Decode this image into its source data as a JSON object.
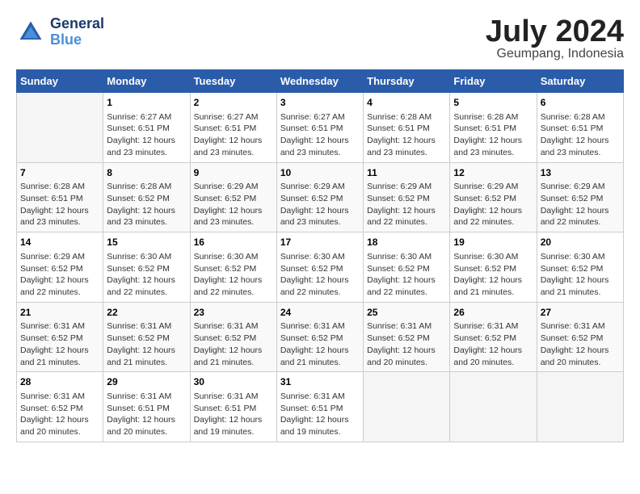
{
  "header": {
    "logo_line1": "General",
    "logo_line2": "Blue",
    "month_year": "July 2024",
    "location": "Geumpang, Indonesia"
  },
  "days_of_week": [
    "Sunday",
    "Monday",
    "Tuesday",
    "Wednesday",
    "Thursday",
    "Friday",
    "Saturday"
  ],
  "weeks": [
    [
      {
        "day": "",
        "info": ""
      },
      {
        "day": "1",
        "info": "Sunrise: 6:27 AM\nSunset: 6:51 PM\nDaylight: 12 hours\nand 23 minutes."
      },
      {
        "day": "2",
        "info": "Sunrise: 6:27 AM\nSunset: 6:51 PM\nDaylight: 12 hours\nand 23 minutes."
      },
      {
        "day": "3",
        "info": "Sunrise: 6:27 AM\nSunset: 6:51 PM\nDaylight: 12 hours\nand 23 minutes."
      },
      {
        "day": "4",
        "info": "Sunrise: 6:28 AM\nSunset: 6:51 PM\nDaylight: 12 hours\nand 23 minutes."
      },
      {
        "day": "5",
        "info": "Sunrise: 6:28 AM\nSunset: 6:51 PM\nDaylight: 12 hours\nand 23 minutes."
      },
      {
        "day": "6",
        "info": "Sunrise: 6:28 AM\nSunset: 6:51 PM\nDaylight: 12 hours\nand 23 minutes."
      }
    ],
    [
      {
        "day": "7",
        "info": "Sunrise: 6:28 AM\nSunset: 6:51 PM\nDaylight: 12 hours\nand 23 minutes."
      },
      {
        "day": "8",
        "info": "Sunrise: 6:28 AM\nSunset: 6:52 PM\nDaylight: 12 hours\nand 23 minutes."
      },
      {
        "day": "9",
        "info": "Sunrise: 6:29 AM\nSunset: 6:52 PM\nDaylight: 12 hours\nand 23 minutes."
      },
      {
        "day": "10",
        "info": "Sunrise: 6:29 AM\nSunset: 6:52 PM\nDaylight: 12 hours\nand 23 minutes."
      },
      {
        "day": "11",
        "info": "Sunrise: 6:29 AM\nSunset: 6:52 PM\nDaylight: 12 hours\nand 22 minutes."
      },
      {
        "day": "12",
        "info": "Sunrise: 6:29 AM\nSunset: 6:52 PM\nDaylight: 12 hours\nand 22 minutes."
      },
      {
        "day": "13",
        "info": "Sunrise: 6:29 AM\nSunset: 6:52 PM\nDaylight: 12 hours\nand 22 minutes."
      }
    ],
    [
      {
        "day": "14",
        "info": "Sunrise: 6:29 AM\nSunset: 6:52 PM\nDaylight: 12 hours\nand 22 minutes."
      },
      {
        "day": "15",
        "info": "Sunrise: 6:30 AM\nSunset: 6:52 PM\nDaylight: 12 hours\nand 22 minutes."
      },
      {
        "day": "16",
        "info": "Sunrise: 6:30 AM\nSunset: 6:52 PM\nDaylight: 12 hours\nand 22 minutes."
      },
      {
        "day": "17",
        "info": "Sunrise: 6:30 AM\nSunset: 6:52 PM\nDaylight: 12 hours\nand 22 minutes."
      },
      {
        "day": "18",
        "info": "Sunrise: 6:30 AM\nSunset: 6:52 PM\nDaylight: 12 hours\nand 22 minutes."
      },
      {
        "day": "19",
        "info": "Sunrise: 6:30 AM\nSunset: 6:52 PM\nDaylight: 12 hours\nand 21 minutes."
      },
      {
        "day": "20",
        "info": "Sunrise: 6:30 AM\nSunset: 6:52 PM\nDaylight: 12 hours\nand 21 minutes."
      }
    ],
    [
      {
        "day": "21",
        "info": "Sunrise: 6:31 AM\nSunset: 6:52 PM\nDaylight: 12 hours\nand 21 minutes."
      },
      {
        "day": "22",
        "info": "Sunrise: 6:31 AM\nSunset: 6:52 PM\nDaylight: 12 hours\nand 21 minutes."
      },
      {
        "day": "23",
        "info": "Sunrise: 6:31 AM\nSunset: 6:52 PM\nDaylight: 12 hours\nand 21 minutes."
      },
      {
        "day": "24",
        "info": "Sunrise: 6:31 AM\nSunset: 6:52 PM\nDaylight: 12 hours\nand 21 minutes."
      },
      {
        "day": "25",
        "info": "Sunrise: 6:31 AM\nSunset: 6:52 PM\nDaylight: 12 hours\nand 20 minutes."
      },
      {
        "day": "26",
        "info": "Sunrise: 6:31 AM\nSunset: 6:52 PM\nDaylight: 12 hours\nand 20 minutes."
      },
      {
        "day": "27",
        "info": "Sunrise: 6:31 AM\nSunset: 6:52 PM\nDaylight: 12 hours\nand 20 minutes."
      }
    ],
    [
      {
        "day": "28",
        "info": "Sunrise: 6:31 AM\nSunset: 6:52 PM\nDaylight: 12 hours\nand 20 minutes."
      },
      {
        "day": "29",
        "info": "Sunrise: 6:31 AM\nSunset: 6:51 PM\nDaylight: 12 hours\nand 20 minutes."
      },
      {
        "day": "30",
        "info": "Sunrise: 6:31 AM\nSunset: 6:51 PM\nDaylight: 12 hours\nand 19 minutes."
      },
      {
        "day": "31",
        "info": "Sunrise: 6:31 AM\nSunset: 6:51 PM\nDaylight: 12 hours\nand 19 minutes."
      },
      {
        "day": "",
        "info": ""
      },
      {
        "day": "",
        "info": ""
      },
      {
        "day": "",
        "info": ""
      }
    ]
  ]
}
